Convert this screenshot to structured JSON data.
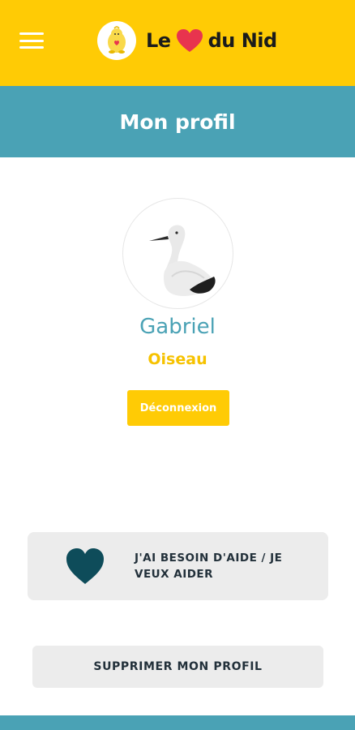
{
  "header": {
    "logo_word_1": "Le",
    "logo_word_2": "du Nid",
    "menu_icon": "hamburger-icon",
    "logo_icon": "bird-mascot-icon",
    "heart_icon": "heart-icon"
  },
  "page": {
    "title": "Mon profil"
  },
  "profile": {
    "name": "Gabriel",
    "role": "Oiseau",
    "avatar_icon": "stork-icon",
    "logout_label": "Déconnexion"
  },
  "actions": {
    "help_label": "J'AI BESOIN D'AIDE / JE VEUX AIDER",
    "help_icon": "heart-icon",
    "delete_label": "SUPPRIMER MON PROFIL"
  },
  "colors": {
    "brand_yellow": "#FFCB05",
    "brand_teal": "#4AA2B5",
    "heart_red": "#E8344E",
    "heart_dark_teal": "#0E4C5A"
  }
}
